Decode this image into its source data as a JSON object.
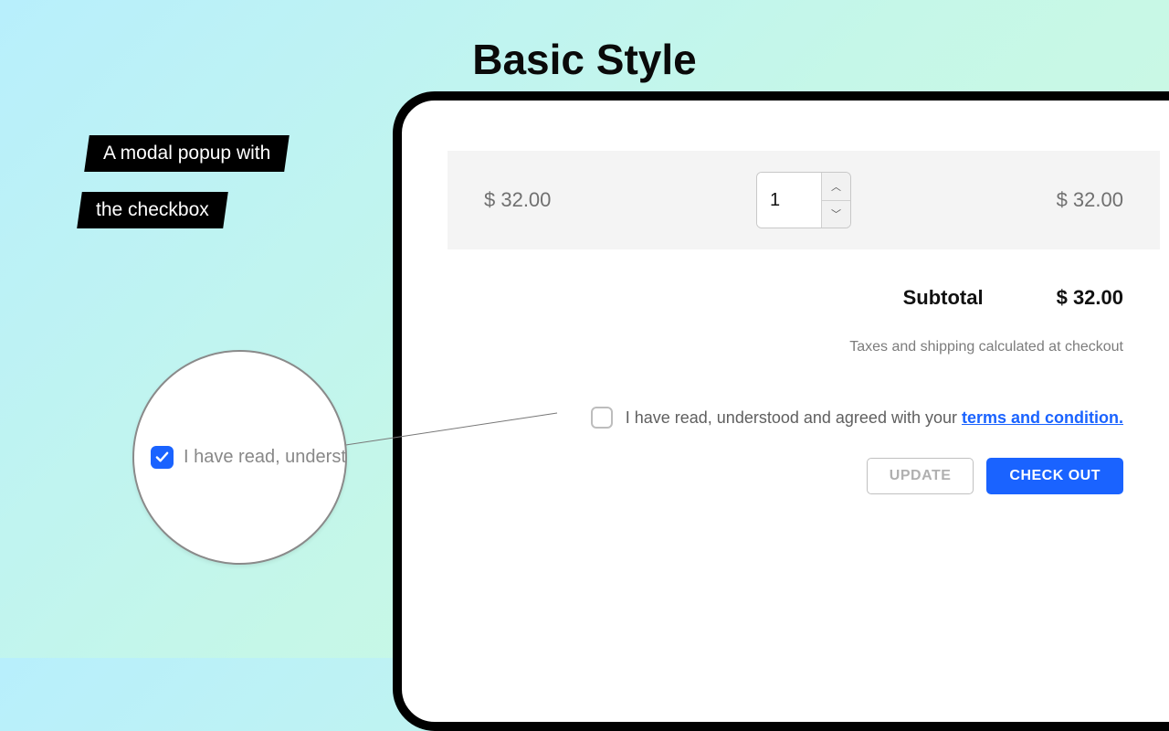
{
  "title": "Basic Style",
  "annotation": {
    "line1": "A modal popup with",
    "line2": "the checkbox"
  },
  "cart": {
    "unit_price": "$ 32.00",
    "quantity": "1",
    "line_total": "$ 32.00",
    "subtotal_label": "Subtotal",
    "subtotal_value": "$ 32.00",
    "tax_note": "Taxes and shipping calculated at checkout"
  },
  "terms": {
    "prefix": "I have read, understood and agreed with your ",
    "link": "terms and condition."
  },
  "buttons": {
    "update": "UPDATE",
    "checkout": "CHECK OUT"
  },
  "magnifier": {
    "text": "I have read, underst"
  }
}
